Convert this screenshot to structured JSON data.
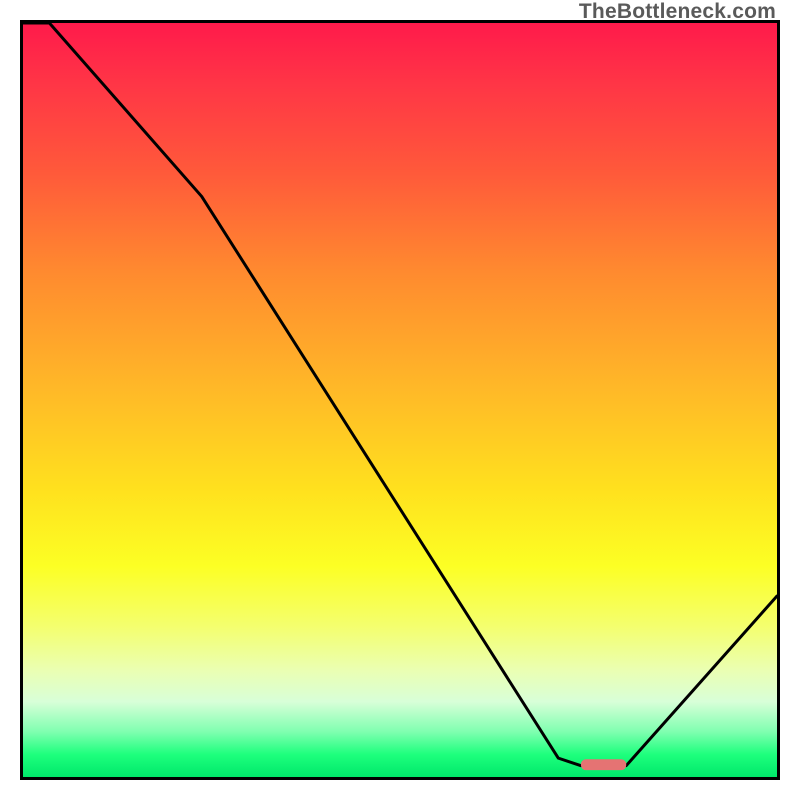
{
  "watermark": "TheBottleneck.com",
  "chart_data": {
    "type": "line",
    "title": "",
    "xlabel": "",
    "ylabel": "",
    "xlim": [
      0,
      100
    ],
    "ylim": [
      0,
      100
    ],
    "series": [
      {
        "name": "curve",
        "x": [
          0,
          3.5,
          23.7,
          71.0,
          74.0,
          80.0,
          100
        ],
        "values": [
          100,
          100,
          77.0,
          2.5,
          1.5,
          1.5,
          24
        ]
      }
    ],
    "marker": {
      "name": "highlight-segment",
      "x_start": 74.0,
      "x_end": 80.0,
      "y": 1.7,
      "color": "#e57373"
    },
    "background": "vertical-gradient red→yellow→green"
  }
}
